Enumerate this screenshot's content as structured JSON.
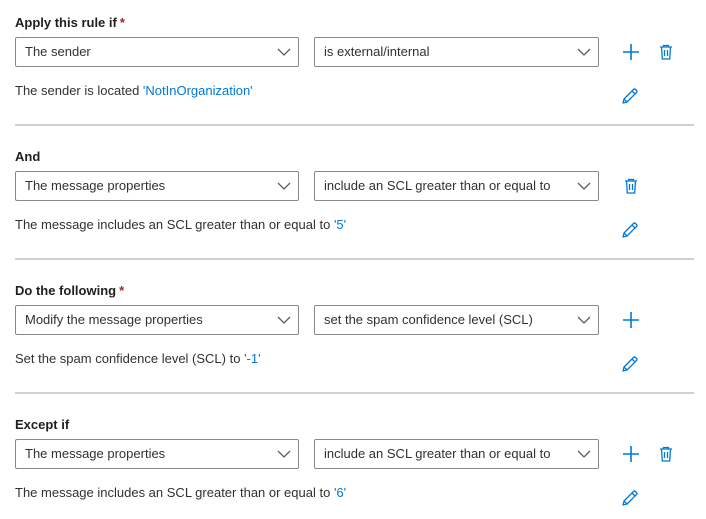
{
  "conditions": {
    "title": "Apply this rule if",
    "required_mark": "*",
    "field": "The sender",
    "operator": "is external/internal",
    "description_prefix": "The sender is located ",
    "description_value": "'NotInOrganization'"
  },
  "and": {
    "title": "And",
    "field": "The message properties",
    "operator": "include an SCL greater than or equal to",
    "description_prefix": "The message includes an SCL greater than or equal to ",
    "description_value": "'5'"
  },
  "actions": {
    "title": "Do the following",
    "required_mark": "*",
    "field": "Modify the message properties",
    "operator": "set the spam confidence level (SCL)",
    "description_prefix": "Set the spam confidence level (SCL) to ",
    "description_value": "'-1'"
  },
  "exceptions": {
    "title": "Except if",
    "field": "The message properties",
    "operator": "include an SCL greater than or equal to",
    "description_prefix": "The message includes an SCL greater than or equal to ",
    "description_value": "'6'"
  },
  "icons": {
    "add": "plus-icon",
    "delete": "trash-icon",
    "edit": "pencil-icon",
    "dropdown": "chevron-down-icon"
  },
  "colors": {
    "accent": "#0078d4",
    "required": "#a4262c",
    "divider": "#d2d0ce",
    "border": "#8a8886"
  }
}
